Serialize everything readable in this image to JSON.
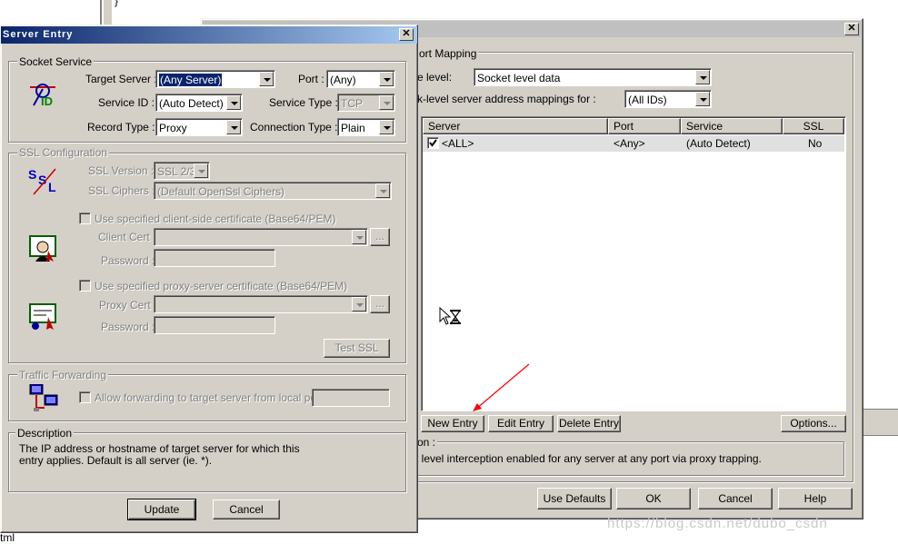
{
  "bg_window": {
    "partial_chars": "}",
    "bottom_text": "tml"
  },
  "port_mapping": {
    "group_title": "ort Mapping",
    "level_label": "e level:",
    "level_value": "Socket level data",
    "mappings_label": "k-level server address mappings for :",
    "mappings_value": "(All IDs)",
    "columns": [
      "Server",
      "Port",
      "Service",
      "SSL"
    ],
    "rows": [
      {
        "server": "<ALL>",
        "port": "<Any>",
        "service": "(Auto Detect)",
        "ssl": "No",
        "checked": true
      }
    ],
    "new_entry": "New Entry",
    "edit_entry": "Edit Entry",
    "delete_entry": "Delete Entry",
    "options": "Options...",
    "desc_title": "on :",
    "desc_text": "t level interception enabled for any server at any port via proxy trapping.",
    "use_defaults": "Use Defaults",
    "ok": "OK",
    "cancel": "Cancel",
    "help": "Help",
    "close_glyph": "✕"
  },
  "server_entry": {
    "title": "Server Entry",
    "close_glyph": "✕",
    "socket_service": {
      "title": "Socket Service",
      "target_server_label": "Target Server :",
      "target_server_value": "(Any Server)",
      "port_label": "Port :",
      "port_value": "(Any)",
      "service_id_label": "Service ID :",
      "service_id_value": "(Auto Detect)",
      "service_type_label": "Service Type :",
      "service_type_value": "TCP",
      "record_type_label": "Record Type :",
      "record_type_value": "Proxy",
      "connection_type_label": "Connection Type :",
      "connection_type_value": "Plain",
      "icon_text": "ID"
    },
    "ssl_config": {
      "title": "SSL Configuration",
      "version_label": "SSL Version :",
      "version_value": "SSL 2/3",
      "ciphers_label": "SSL Ciphers :",
      "ciphers_value": "(Default OpenSsl Ciphers)",
      "client_cert_check": "Use specified client-side certificate (Base64/PEM)",
      "client_cert_label": "Client Cert :",
      "client_password_label": "Password :",
      "proxy_cert_check": "Use specified proxy-server certificate (Base64/PEM)",
      "proxy_cert_label": "Proxy Cert :",
      "proxy_password_label": "Password :",
      "browse_label": "...",
      "test_ssl": "Test SSL",
      "icon_s1": "S",
      "icon_s2": "S",
      "icon_l": "L"
    },
    "traffic": {
      "title": "Traffic Forwarding",
      "allow_check": "Allow forwarding to target server from local port :"
    },
    "description": {
      "title": "Description",
      "text": "The IP address or hostname of target server for which this entry applies.  Default is all server (ie. *)."
    },
    "update": "Update",
    "cancel": "Cancel"
  },
  "watermark": "https://blog.csdn.net/dubo_csdn"
}
